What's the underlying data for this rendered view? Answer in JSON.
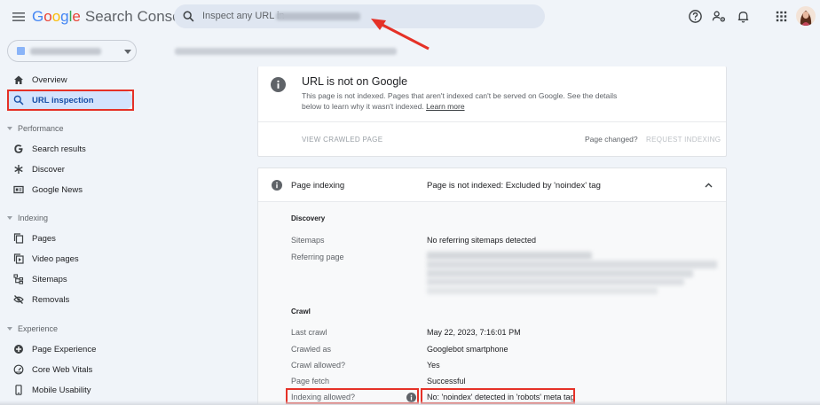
{
  "app": {
    "logo_parts": [
      "G",
      "o",
      "o",
      "g",
      "l",
      "e"
    ],
    "product": "Search Console"
  },
  "search": {
    "placeholder": "Inspect any URL in"
  },
  "sidebar": {
    "items_top": [
      {
        "label": "Overview",
        "icon": "home-icon"
      },
      {
        "label": "URL inspection",
        "icon": "search-icon",
        "active": true
      }
    ],
    "sections": [
      {
        "label": "Performance",
        "items": [
          {
            "label": "Search results",
            "icon": "google-g-icon"
          },
          {
            "label": "Discover",
            "icon": "asterisk-icon"
          },
          {
            "label": "Google News",
            "icon": "news-icon"
          }
        ]
      },
      {
        "label": "Indexing",
        "items": [
          {
            "label": "Pages",
            "icon": "pages-icon"
          },
          {
            "label": "Video pages",
            "icon": "video-icon"
          },
          {
            "label": "Sitemaps",
            "icon": "sitemap-icon"
          },
          {
            "label": "Removals",
            "icon": "eye-off-icon"
          }
        ]
      },
      {
        "label": "Experience",
        "items": [
          {
            "label": "Page Experience",
            "icon": "plus-circle-icon"
          },
          {
            "label": "Core Web Vitals",
            "icon": "gauge-icon"
          },
          {
            "label": "Mobile Usability",
            "icon": "phone-icon"
          }
        ]
      }
    ]
  },
  "status_card": {
    "title": "URL is not on Google",
    "description": "This page is not indexed. Pages that aren't indexed can't be served on Google. See the details below to learn why it wasn't indexed.",
    "learn_more": "Learn more",
    "view_crawled": "VIEW CRAWLED PAGE",
    "page_changed": "Page changed?",
    "request_indexing": "REQUEST INDEXING"
  },
  "indexing_card": {
    "label": "Page indexing",
    "status": "Page is not indexed: Excluded by 'noindex' tag",
    "discovery": {
      "heading": "Discovery",
      "rows": [
        {
          "key": "Sitemaps",
          "value": "No referring sitemaps detected"
        },
        {
          "key": "Referring page",
          "value": ""
        }
      ]
    },
    "crawl": {
      "heading": "Crawl",
      "rows": [
        {
          "key": "Last crawl",
          "value": "May 22, 2023, 7:16:01 PM"
        },
        {
          "key": "Crawled as",
          "value": "Googlebot smartphone"
        },
        {
          "key": "Crawl allowed?",
          "value": "Yes"
        },
        {
          "key": "Page fetch",
          "value": "Successful"
        },
        {
          "key": "Indexing allowed?",
          "value": "No: 'noindex' detected in 'robots' meta tag"
        }
      ]
    }
  },
  "colors": {
    "accent_blue": "#1a73e8",
    "highlight_red": "#e53127",
    "active_nav_bg": "#d3e3fd",
    "page_bg": "#f0f4f9"
  }
}
